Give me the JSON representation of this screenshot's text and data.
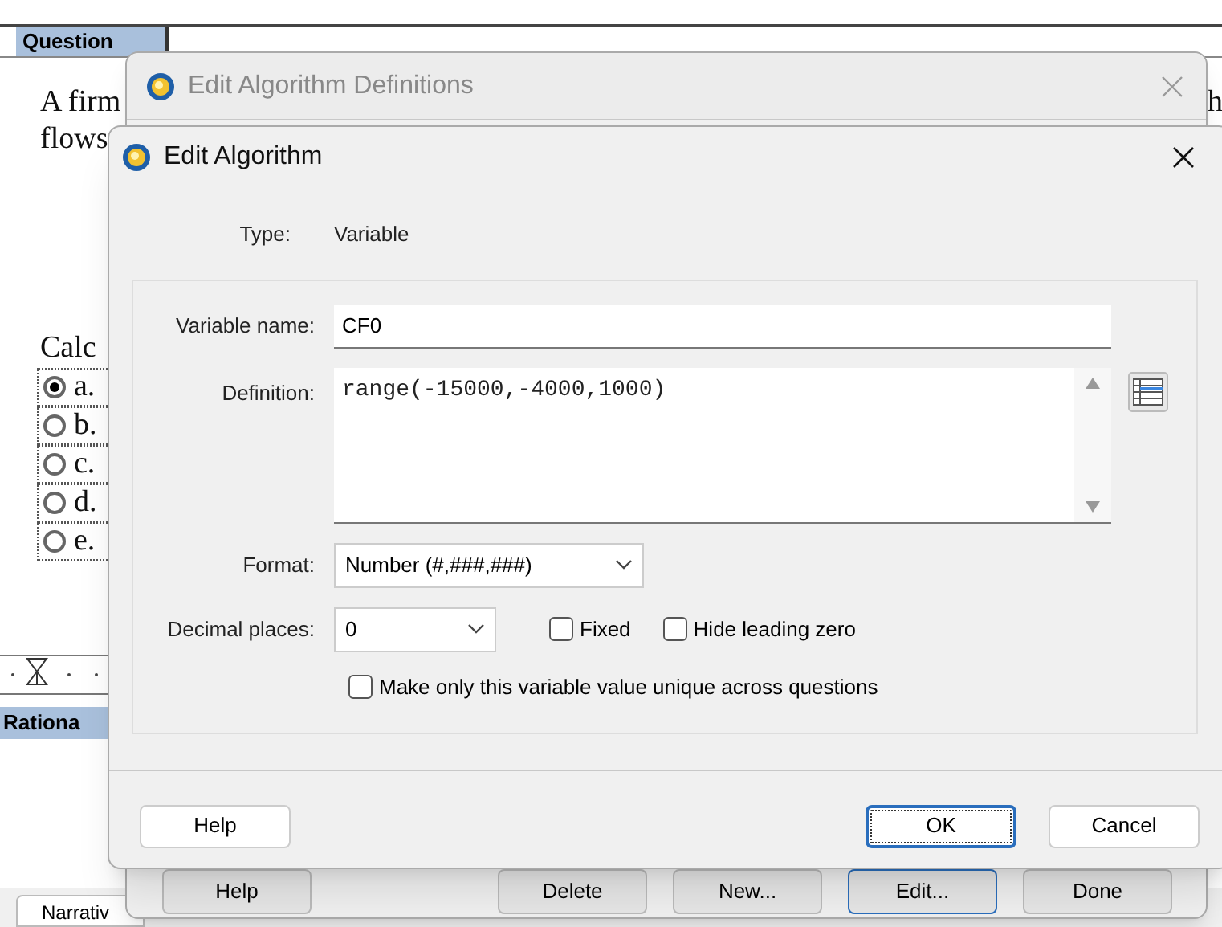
{
  "document": {
    "question_tab": "Question",
    "text_lines": [
      "A firm",
      "flows"
    ],
    "edge_fragment": "h",
    "prompt": "Calc",
    "answers": [
      {
        "label": "a.",
        "selected": true
      },
      {
        "label": "b.",
        "selected": false
      },
      {
        "label": "c.",
        "selected": false
      },
      {
        "label": "d.",
        "selected": false
      },
      {
        "label": "e.",
        "selected": false
      }
    ],
    "rationale_tab": "Rationa",
    "bottom_tab": "Narrativ"
  },
  "definitions_dialog": {
    "title": "Edit Algorithm Definitions",
    "buttons": [
      {
        "label": "Help",
        "focused": false
      },
      {
        "label": "Delete",
        "focused": false
      },
      {
        "label": "New...",
        "focused": false
      },
      {
        "label": "Edit...",
        "focused": true
      },
      {
        "label": "Done",
        "focused": false
      }
    ]
  },
  "algorithm_dialog": {
    "title": "Edit Algorithm",
    "type_label": "Type:",
    "type_value": "Variable",
    "variable_name": {
      "label": "Variable name:",
      "value": "CF0"
    },
    "definition": {
      "label": "Definition:",
      "value": "range(-15000,-4000,1000)"
    },
    "format": {
      "label": "Format:",
      "value": "Number (#,###,###)"
    },
    "decimal_places": {
      "label": "Decimal places:",
      "value": "0"
    },
    "options": [
      {
        "label": "Fixed",
        "checked": false
      },
      {
        "label": "Hide leading zero",
        "checked": false
      }
    ],
    "unique": {
      "label": "Make only this variable value unique across questions",
      "checked": false
    },
    "buttons": [
      {
        "label": "Help",
        "focused": false
      },
      {
        "label": "OK",
        "focused": true
      },
      {
        "label": "Cancel",
        "focused": false
      }
    ]
  }
}
